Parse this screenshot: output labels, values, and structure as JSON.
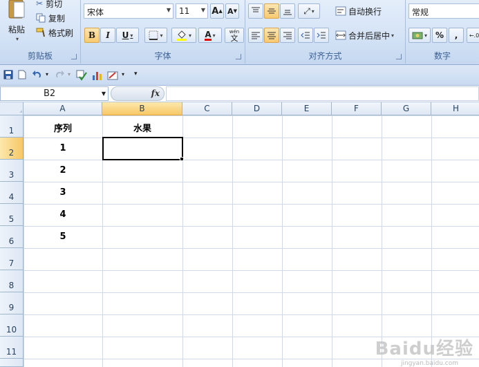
{
  "clipboard": {
    "paste_label": "粘贴",
    "cut_label": "剪切",
    "copy_label": "复制",
    "format_painter_label": "格式刷",
    "group_label": "剪贴板"
  },
  "font": {
    "font_name": "宋体",
    "font_size": "11",
    "grow_label": "A",
    "shrink_label": "A",
    "bold_label": "B",
    "italic_label": "I",
    "underline_label": "U",
    "font_color_label": "A",
    "phonetic_label": "wén",
    "phonetic_char": "文",
    "group_label": "字体"
  },
  "alignment": {
    "wrap_text_label": "自动换行",
    "merge_center_label": "合并后居中",
    "group_label": "对齐方式"
  },
  "number": {
    "format_value": "常规",
    "percent_label": "%",
    "comma_label": ",",
    "group_label": "数字"
  },
  "formula_bar": {
    "name_box": "B2",
    "fx_label": "fx",
    "formula_value": ""
  },
  "sheet": {
    "columns": [
      "A",
      "B",
      "C",
      "D",
      "E",
      "F",
      "G",
      "H"
    ],
    "rows": [
      "1",
      "2",
      "3",
      "4",
      "5",
      "6",
      "7",
      "8",
      "9",
      "10",
      "11"
    ],
    "cells": {
      "A1": "序列",
      "B1": "水果",
      "A2": "1",
      "A3": "2",
      "A4": "3",
      "A5": "4",
      "A6": "5"
    },
    "active_cell": "B2"
  },
  "watermark": {
    "brand": "Baidu经验",
    "url": "jingyan.baidu.com"
  },
  "colors": {
    "ribbon_blue": "#d3e2f5",
    "selected_header": "#f7c765",
    "group_label_text": "#3b5f93",
    "grid_line": "#d0d7e5"
  }
}
